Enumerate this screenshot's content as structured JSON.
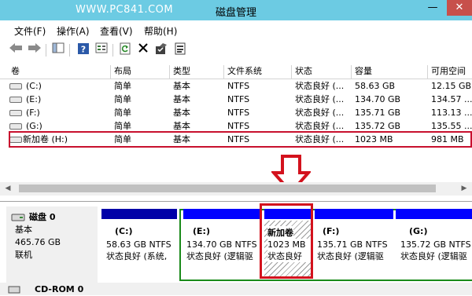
{
  "watermark": "WWW.PC841.COM",
  "window": {
    "title": "磁盘管理",
    "minimize": "—",
    "close": "✕"
  },
  "menu": [
    "文件(F)",
    "操作(A)",
    "查看(V)",
    "帮助(H)"
  ],
  "toolbar_icons": [
    "back-arrow-icon",
    "forward-arrow-icon",
    "console-tree-icon",
    "help-icon",
    "properties-list-icon",
    "refresh-icon",
    "delete-x-icon",
    "folder-check-icon",
    "properties-icon"
  ],
  "columns": [
    "卷",
    "布局",
    "类型",
    "文件系统",
    "状态",
    "容量",
    "可用空间"
  ],
  "volumes": [
    {
      "name": "(C:)",
      "layout": "简单",
      "type": "基本",
      "fs": "NTFS",
      "status": "状态良好 (...",
      "capacity": "58.63 GB",
      "free": "12.15 GB"
    },
    {
      "name": "(E:)",
      "layout": "简单",
      "type": "基本",
      "fs": "NTFS",
      "status": "状态良好 (...",
      "capacity": "134.70 GB",
      "free": "134.57 ..."
    },
    {
      "name": "(F:)",
      "layout": "简单",
      "type": "基本",
      "fs": "NTFS",
      "status": "状态良好 (...",
      "capacity": "135.71 GB",
      "free": "113.13 ..."
    },
    {
      "name": "(G:)",
      "layout": "简单",
      "type": "基本",
      "fs": "NTFS",
      "status": "状态良好 (...",
      "capacity": "135.72 GB",
      "free": "135.55 ..."
    },
    {
      "name": "新加卷 (H:)",
      "layout": "简单",
      "type": "基本",
      "fs": "NTFS",
      "status": "状态良好 (...",
      "capacity": "1023 MB",
      "free": "981 MB"
    }
  ],
  "disk": {
    "name": "磁盘 0",
    "kind": "基本",
    "size": "465.76 GB",
    "state": "联机"
  },
  "partitions": [
    {
      "label": "(C:)",
      "size": "58.63 GB NTFS",
      "status": "状态良好 (系统,"
    },
    {
      "label": "(E:)",
      "size": "134.70 GB NTFS",
      "status": "状态良好 (逻辑驱"
    },
    {
      "label": "新加卷",
      "size": "1023 MB",
      "status": "状态良好"
    },
    {
      "label": "(F:)",
      "size": "135.71 GB NTFS",
      "status": "状态良好 (逻辑驱"
    },
    {
      "label": "(G:)",
      "size": "135.72 GB NTFS",
      "status": "状态良好 (逻辑驱"
    }
  ],
  "cdrom": "CD-ROM 0",
  "colors": {
    "titlebar": "#6ccbe3",
    "primary": "#0000a8",
    "extended": "#1a8a1a",
    "logical": "#0000ff",
    "highlight": "#c8102e"
  }
}
